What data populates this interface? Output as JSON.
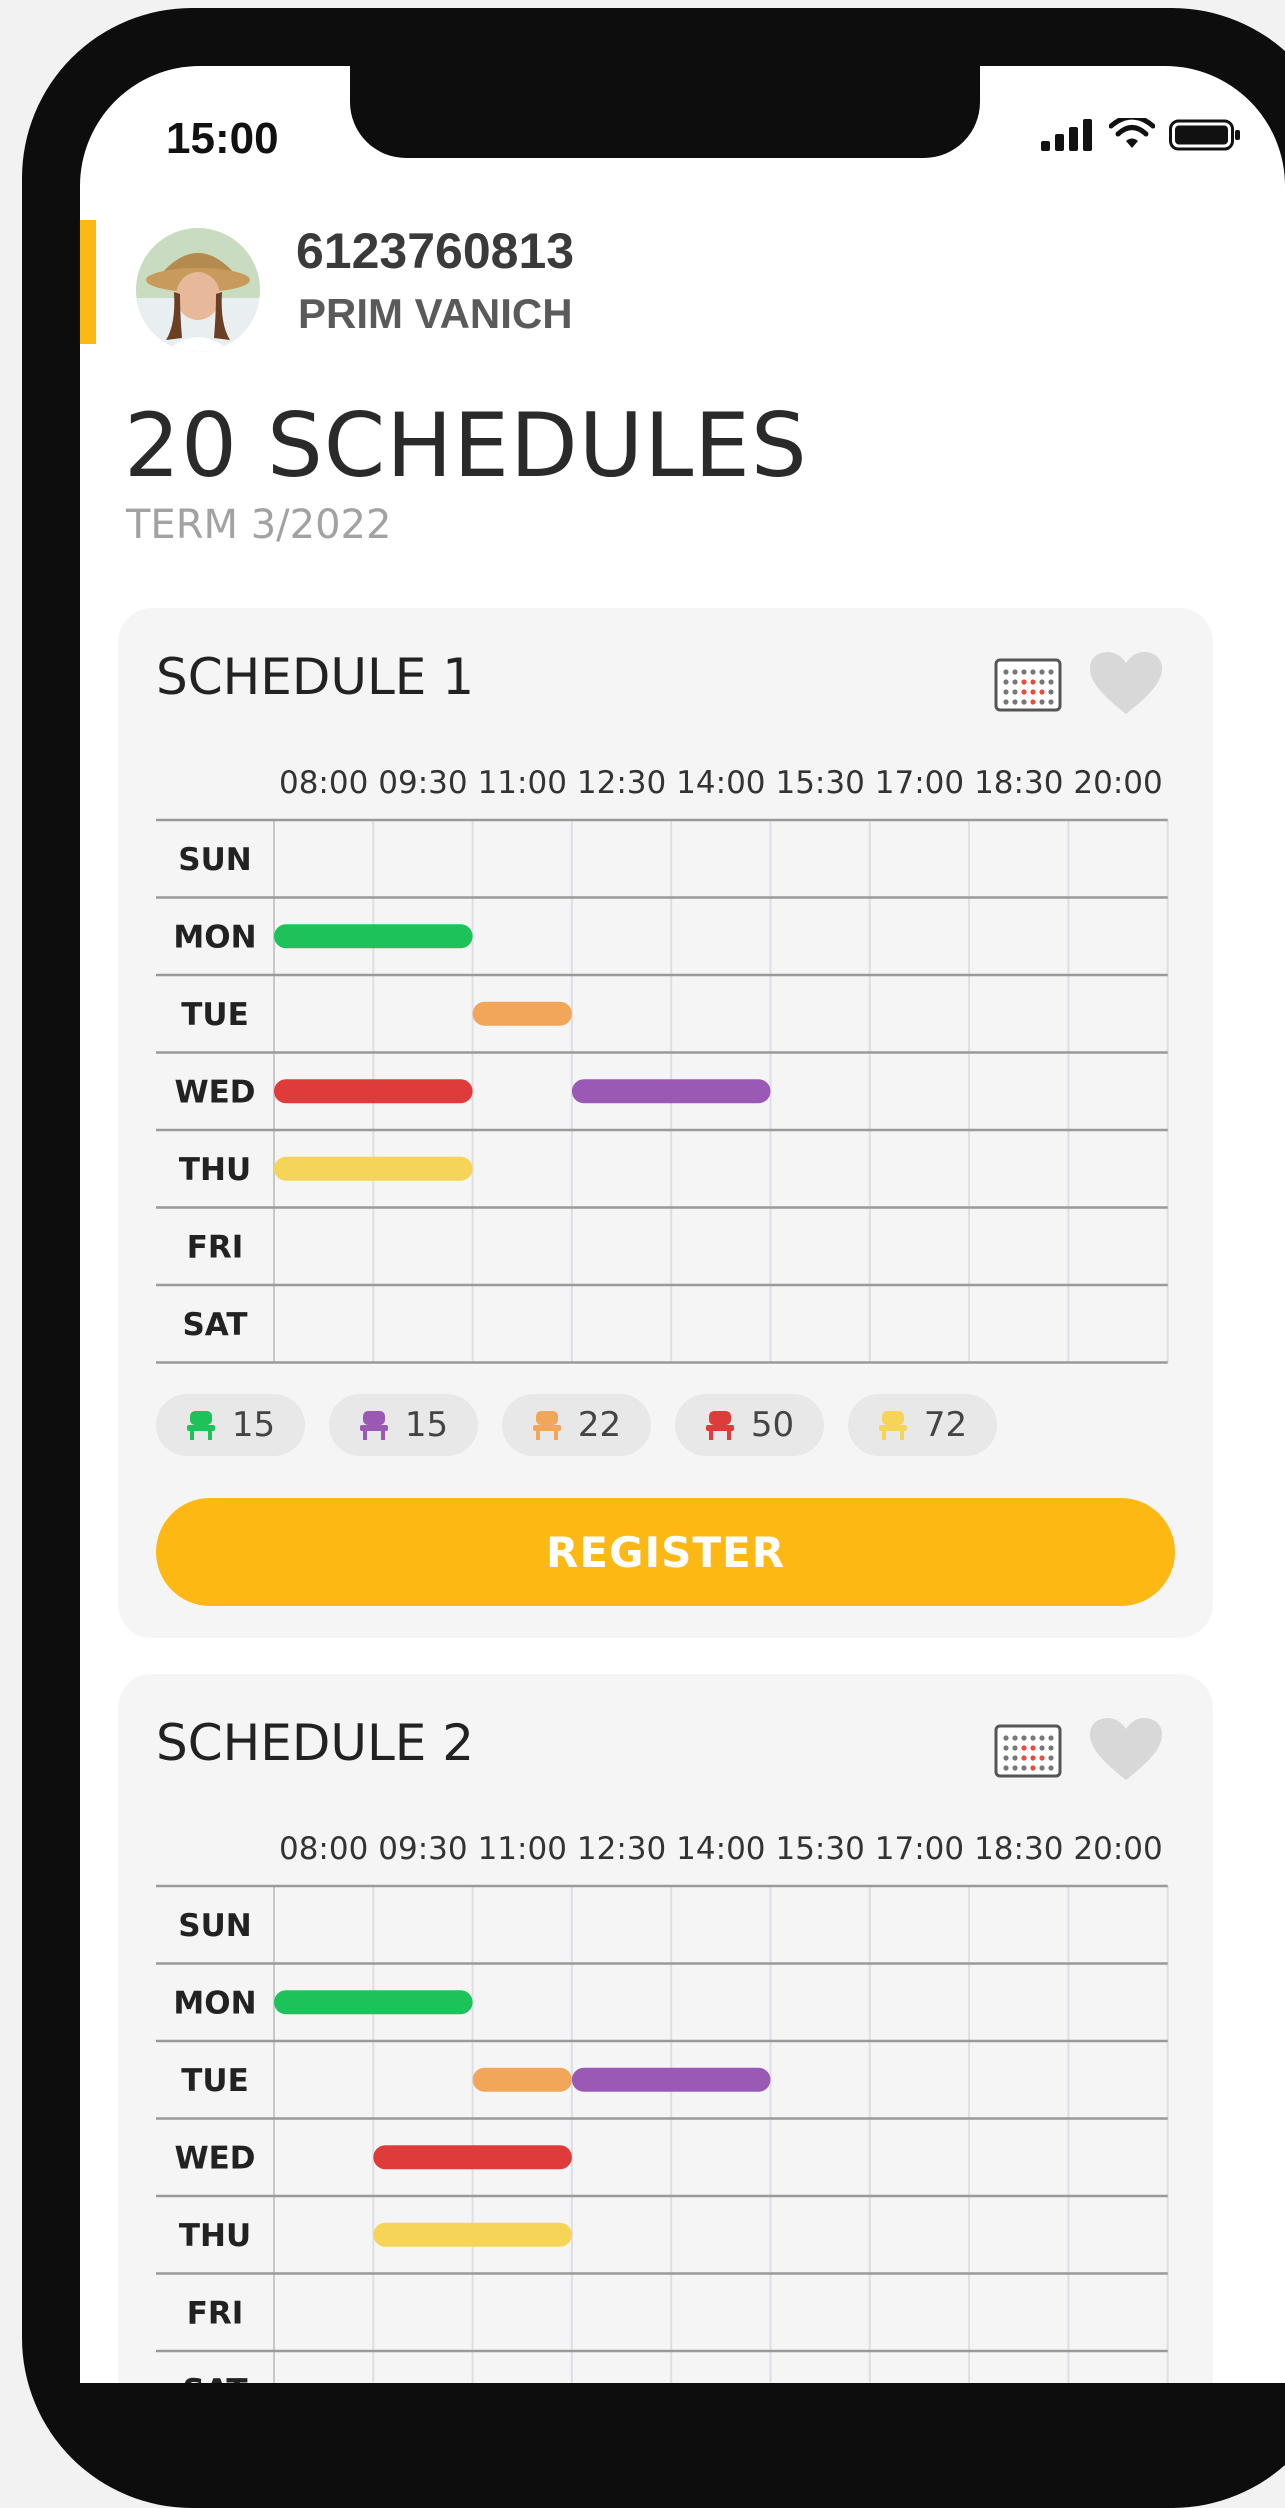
{
  "status_bar": {
    "time": "15:00"
  },
  "profile": {
    "student_id": "6123760813",
    "name": "PRIM VANICH"
  },
  "page": {
    "title": "20 SCHEDULES",
    "term": "TERM 3/2022"
  },
  "colors": {
    "accent": "#fdb813",
    "green": "#1dc35a",
    "orange": "#f2a65a",
    "red": "#e03b3b",
    "purple": "#9b59b6",
    "yellow": "#f6d458"
  },
  "time_labels": [
    "08:00",
    "09:30",
    "11:00",
    "12:30",
    "14:00",
    "15:30",
    "17:00",
    "18:30",
    "20:00"
  ],
  "days": [
    "SUN",
    "MON",
    "TUE",
    "WED",
    "THU",
    "FRI",
    "SAT"
  ],
  "schedules": [
    {
      "title": "SCHEDULE 1",
      "register_label": "REGISTER",
      "classes": [
        {
          "day": "MON",
          "start": "08:00",
          "end": "11:00",
          "color": "green"
        },
        {
          "day": "TUE",
          "start": "11:00",
          "end": "12:30",
          "color": "orange"
        },
        {
          "day": "WED",
          "start": "08:00",
          "end": "11:00",
          "color": "red"
        },
        {
          "day": "WED",
          "start": "12:30",
          "end": "15:30",
          "color": "purple"
        },
        {
          "day": "THU",
          "start": "08:00",
          "end": "11:00",
          "color": "yellow"
        }
      ],
      "seats": [
        {
          "color": "green",
          "count": "15"
        },
        {
          "color": "purple",
          "count": "15"
        },
        {
          "color": "orange",
          "count": "22"
        },
        {
          "color": "red",
          "count": "50"
        },
        {
          "color": "yellow",
          "count": "72"
        }
      ]
    },
    {
      "title": "SCHEDULE 2",
      "classes": [
        {
          "day": "MON",
          "start": "08:00",
          "end": "11:00",
          "color": "green"
        },
        {
          "day": "TUE",
          "start": "11:00",
          "end": "12:30",
          "color": "orange"
        },
        {
          "day": "TUE",
          "start": "12:30",
          "end": "15:30",
          "color": "purple"
        },
        {
          "day": "WED",
          "start": "09:30",
          "end": "12:30",
          "color": "red"
        },
        {
          "day": "THU",
          "start": "09:30",
          "end": "12:30",
          "color": "yellow"
        }
      ]
    }
  ]
}
